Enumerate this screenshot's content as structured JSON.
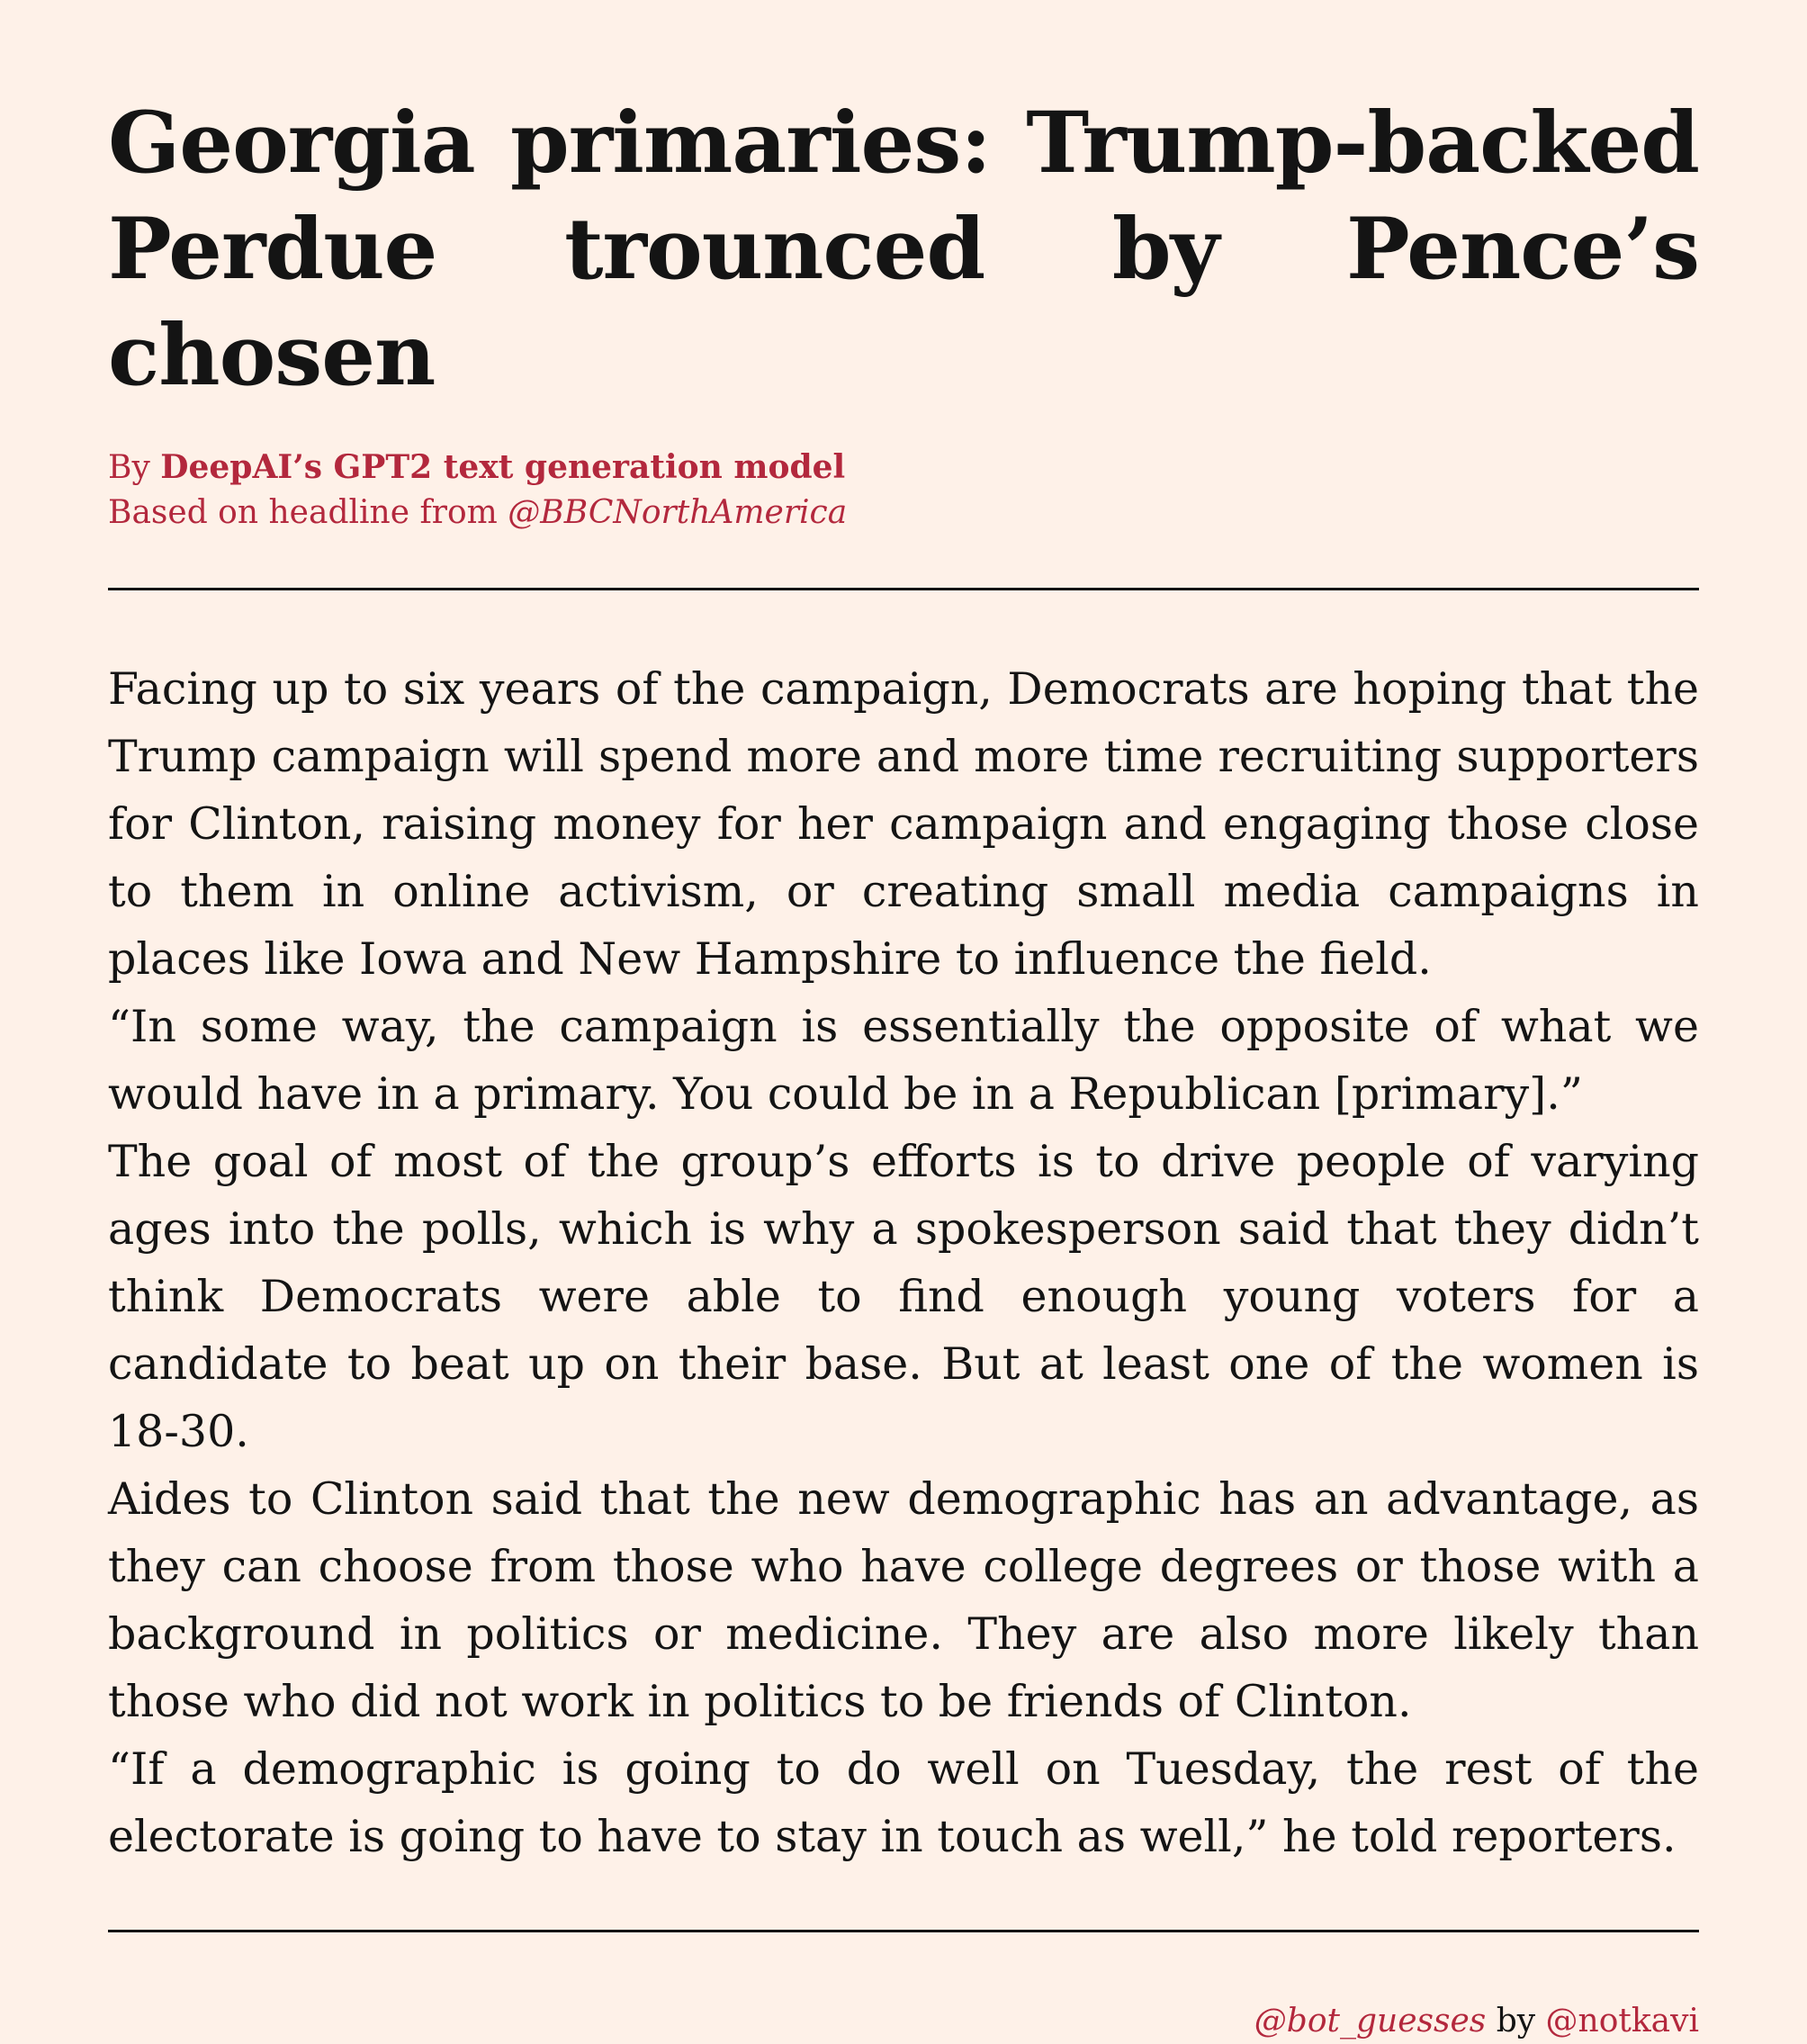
{
  "headline": "Georgia primaries: Trump-backed Perdue trounced by Pence’s chosen",
  "byline": {
    "by_prefix": "By ",
    "author": "DeepAI’s GPT2 text generation model",
    "source_prefix": "Based on headline from ",
    "source_handle": "@BBCNorthAmerica"
  },
  "article": {
    "paragraphs": [
      "Facing up to six years of the campaign, Democrats are hoping that the Trump campaign will spend more and more time recruiting supporters for Clinton, raising money for her campaign and engaging those close to them in online activism, or creating small media campaigns in places like Iowa and New Hampshire to influence the field.",
      "“In some way, the campaign is essentially the opposite of what we would have in a primary. You could be in a Republican [primary].”",
      "The goal of most of the group’s efforts is to drive people of varying ages into the polls, which is why a spokesperson said that they didn’t think Democrats were able to find enough young voters for a candidate to beat up on their base. But at least one of the women is 18-30.",
      "Aides to Clinton said that the new demographic has an advantage, as they can choose from those who have college degrees or those with a background in politics or medicine. They are also more likely than those who did not work in politics to be friends of Clinton.",
      "“If a demographic is going to do well on Tuesday, the rest of the electorate is going to have to stay in touch as well,” he told reporters."
    ]
  },
  "credit": {
    "bot_handle": "@bot_guesses",
    "by_word": " by ",
    "author_handle": "@notkavi"
  },
  "colors": {
    "background": "#fef1e8",
    "accent": "#b3283d",
    "text": "#141414"
  }
}
